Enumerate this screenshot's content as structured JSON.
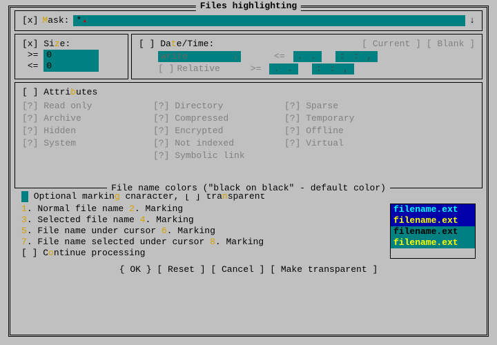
{
  "title": "Files highlighting",
  "mask": {
    "checkbox": "[x]",
    "label_pre": "M",
    "label_post": "ask:",
    "value": "*"
  },
  "size": {
    "checkbox": "[x]",
    "label_pre": "Si",
    "hotkey": "z",
    "label_post": "e:",
    "ge": ">=",
    "ge_val": "0",
    "le": "<=",
    "le_val": "0"
  },
  "datetime": {
    "checkbox": "[ ]",
    "label_pre": "Da",
    "hotkey": "t",
    "label_post": "e/Time:",
    "btn_current": "[ Current ]",
    "btn_blank": "[ Blank ]",
    "dropdown": "write",
    "rel_checkbox": "[ ]",
    "rel_label": "Relative",
    "le": "<=",
    "ge": ">=",
    "date_placeholder": ".  .",
    "time_placeholder": ":  : ,"
  },
  "attrs": {
    "checkbox": "[ ]",
    "label_pre": "Attri",
    "hotkey": "b",
    "label_post": "utes",
    "items": [
      "[?] Read only",
      "[?] Directory",
      "[?] Sparse",
      "[?] Archive",
      "[?] Compressed",
      "[?] Temporary",
      "[?] Hidden",
      "[?] Encrypted",
      "[?] Offline",
      "[?] System",
      "[?] Not indexed",
      "[?] Virtual",
      "",
      "[?] Symbolic link",
      ""
    ]
  },
  "colors_title": "File name colors (\"black on black\" - default color)",
  "colors": {
    "opt_pre": " Optional markin",
    "opt_hot": "g",
    "opt_mid": " character, [ ] tra",
    "opt_hot2": "n",
    "opt_post": "sparent",
    "rows": [
      {
        "n1": "1",
        "t1": ". Normal file name",
        "n2": "2",
        "t2": ". Marking"
      },
      {
        "n1": "3",
        "t1": ". Selected file name",
        "n2": "4",
        "t2": ". Marking"
      },
      {
        "n1": "5",
        "t1": ". File name under cursor",
        "n2": "6",
        "t2": ". Marking"
      },
      {
        "n1": "7",
        "t1": ". File name selected under cursor",
        "n2": "8",
        "t2": ". Marking"
      }
    ],
    "cont_cb": "[ ]",
    "cont_pre": " C",
    "cont_hot": "o",
    "cont_post": "ntinue processing",
    "preview": [
      "filename.ext",
      "filename.ext",
      "filename.ext",
      "filename.ext"
    ]
  },
  "buttons": {
    "ok": "{ OK }",
    "reset": "[ Reset ]",
    "cancel": "[ Cancel ]",
    "transparent": "[ Make transparent ]"
  }
}
